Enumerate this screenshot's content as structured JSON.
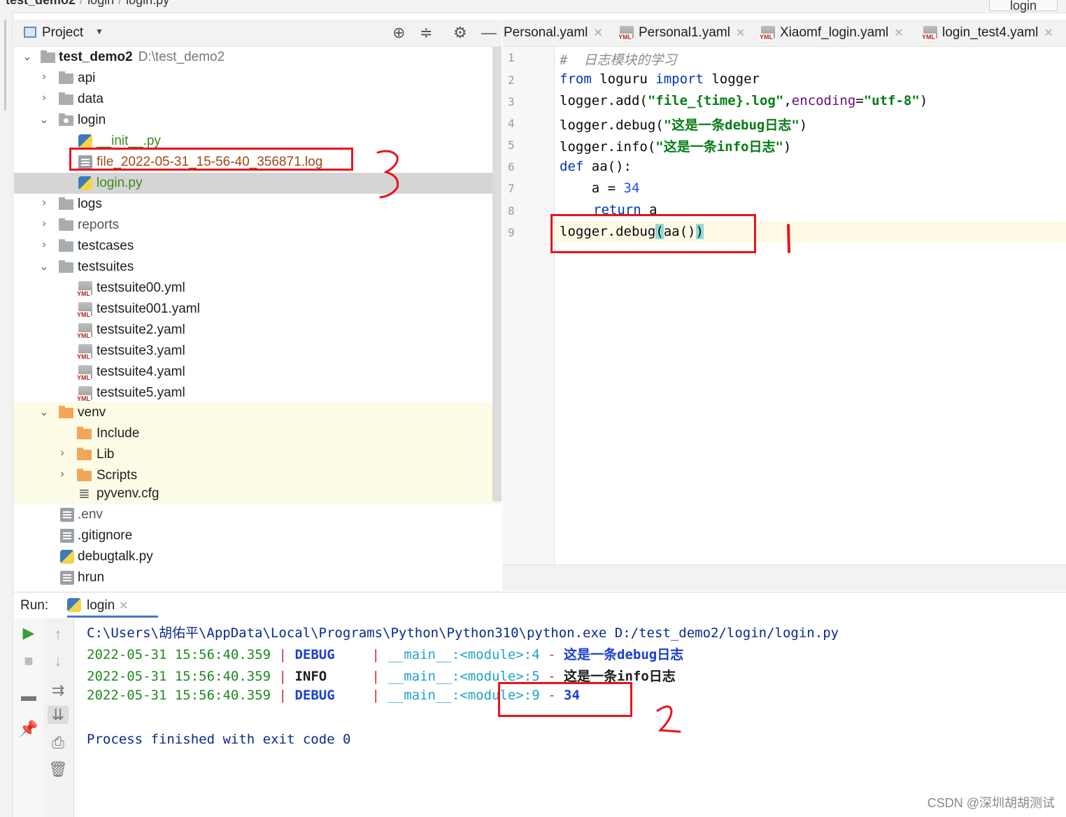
{
  "breadcrumb": {
    "project": "test_demo2",
    "folder": "login",
    "file": "login.py",
    "right_tab": "login"
  },
  "project_panel": {
    "title": "Project",
    "root": {
      "name": "test_demo2",
      "path": "D:\\test_demo2"
    },
    "items": [
      {
        "label": "api"
      },
      {
        "label": "data"
      },
      {
        "label": "login"
      },
      {
        "label": "__init__.py"
      },
      {
        "label": "file_2022-05-31_15-56-40_356871.log"
      },
      {
        "label": "login.py"
      },
      {
        "label": "logs"
      },
      {
        "label": "reports"
      },
      {
        "label": "testcases"
      },
      {
        "label": "testsuites"
      },
      {
        "label": "testsuite00.yml"
      },
      {
        "label": "testsuite001.yaml"
      },
      {
        "label": "testsuite2.yaml"
      },
      {
        "label": "testsuite3.yaml"
      },
      {
        "label": "testsuite4.yaml"
      },
      {
        "label": "testsuite5.yaml"
      },
      {
        "label": "venv"
      },
      {
        "label": "Include"
      },
      {
        "label": "Lib"
      },
      {
        "label": "Scripts"
      },
      {
        "label": "pyvenv.cfg"
      },
      {
        "label": ".env"
      },
      {
        "label": ".gitignore"
      },
      {
        "label": "debugtalk.py"
      },
      {
        "label": "hrun"
      }
    ]
  },
  "editor": {
    "tabs": [
      {
        "label": "Personal.yaml"
      },
      {
        "label": "Personal1.yaml"
      },
      {
        "label": "Xiaomf_login.yaml"
      },
      {
        "label": "login_test4.yaml"
      }
    ],
    "line_numbers": [
      "1",
      "2",
      "3",
      "4",
      "5",
      "6",
      "7",
      "8",
      "9"
    ],
    "code": {
      "l1_comment": "#  日志模块的学习",
      "l2_from": "from",
      "l2_mod": " loguru ",
      "l2_import": "import",
      "l2_name": " logger",
      "l3_pre": "logger.add(",
      "l3_str1": "\"file_{time}.log\"",
      "l3_comma": ",",
      "l3_param": "encoding",
      "l3_eq": "=",
      "l3_str2": "\"utf-8\"",
      "l3_end": ")",
      "l4_pre": "logger.debug(",
      "l4_str": "\"这是一条debug日志\"",
      "l4_end": ")",
      "l5_pre": "logger.info(",
      "l5_str": "\"这是一条info日志\"",
      "l5_end": ")",
      "l6_def": "def",
      "l6_rest": " aa():",
      "l7_pre": "    a = ",
      "l7_num": "34",
      "l8_ret": "return",
      "l8_rest": " a",
      "l9_pre": "logger.debug",
      "l9_open": "(",
      "l9_mid": "aa()",
      "l9_close": ")"
    }
  },
  "run_panel": {
    "label": "Run:",
    "tab": "login",
    "console": {
      "command": "C:\\Users\\胡佑平\\AppData\\Local\\Programs\\Python\\Python310\\python.exe D:/test_demo2/login/login.py",
      "lines": [
        {
          "date": "2022-05-31 15:56:40.359",
          "level": "DEBUG",
          "module": "__main__:<module>:",
          "lineno": "4",
          "message": "这是一条debug日志"
        },
        {
          "date": "2022-05-31 15:56:40.359",
          "level": "INFO",
          "module": "__main__:<module>:",
          "lineno": "5",
          "message": "这是一条info日志"
        },
        {
          "date": "2022-05-31 15:56:40.359",
          "level": "DEBUG",
          "module": "__main__:<module>:",
          "lineno": "9",
          "message": "34"
        }
      ],
      "finished": "Process finished with exit code 0"
    }
  },
  "watermark": "CSDN @深圳胡胡测试",
  "colors": {
    "annotation_red": "#e8141b",
    "keyword": "#0033b3",
    "string": "#067d17",
    "selection": "#d5d5d5"
  }
}
